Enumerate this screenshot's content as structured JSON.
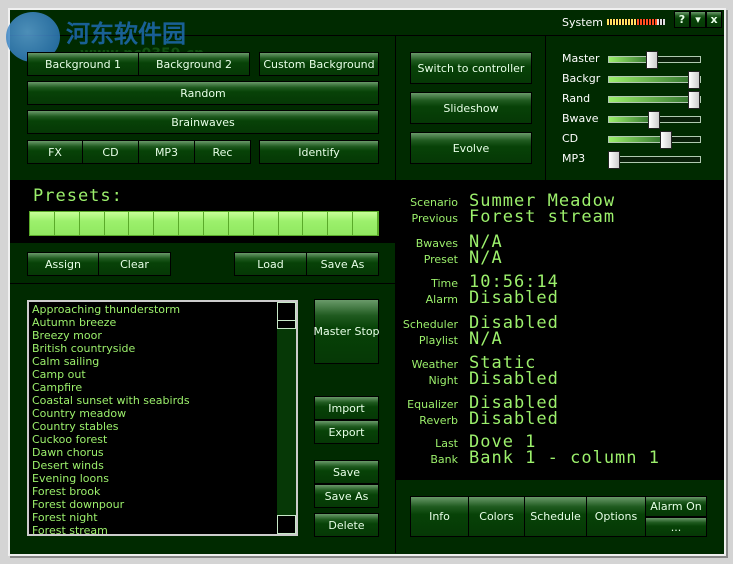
{
  "watermark": {
    "name": "河东软件园",
    "url": "www.pc0359.cn"
  },
  "titlebar": {
    "system_label": "System",
    "help": "?",
    "minimize": "▾",
    "close": "x"
  },
  "colors": {
    "background": "#002a00",
    "display_text": "#9cf06c",
    "display_bg": "#000000"
  },
  "background_buttons": {
    "bg1": "Background 1",
    "bg2": "Background 2",
    "custom": "Custom Background",
    "random": "Random",
    "brainwaves": "Brainwaves",
    "fx": "FX",
    "cd": "CD",
    "mp3": "MP3",
    "rec": "Rec",
    "identify": "Identify"
  },
  "mode_buttons": {
    "switch": "Switch to controller",
    "slideshow": "Slideshow",
    "evolve": "Evolve"
  },
  "sliders": [
    {
      "label": "Master",
      "value": 0.48
    },
    {
      "label": "Backgr",
      "value": 1.0
    },
    {
      "label": "Rand",
      "value": 1.0
    },
    {
      "label": "Bwave",
      "value": 0.5
    },
    {
      "label": "CD",
      "value": 0.65
    },
    {
      "label": "MP3",
      "value": 0.0
    }
  ],
  "presets": {
    "title": "Presets:",
    "slots": 14,
    "assign": "Assign",
    "clear": "Clear",
    "load": "Load",
    "save_as": "Save As"
  },
  "scenarios": [
    "Approaching thunderstorm",
    "Autumn breeze",
    "Breezy moor",
    "British countryside",
    "Calm sailing",
    "Camp out",
    "Campfire",
    "Coastal sunset with seabirds",
    "Country meadow",
    "Country stables",
    "Cuckoo forest",
    "Dawn chorus",
    "Desert winds",
    "Evening loons",
    "Forest brook",
    "Forest downpour",
    "Forest night",
    "Forest stream"
  ],
  "side_buttons": {
    "master_stop": "Master Stop",
    "import": "Import",
    "export": "Export",
    "save": "Save",
    "save_as": "Save As",
    "delete": "Delete"
  },
  "info": [
    {
      "label": "Scenario",
      "value": "Summer Meadow"
    },
    {
      "label": "Previous",
      "value": "Forest stream"
    },
    {
      "label": "Bwaves",
      "value": "N/A"
    },
    {
      "label": "Preset",
      "value": "N/A"
    },
    {
      "label": "Time",
      "value": "10:56:14"
    },
    {
      "label": "Alarm",
      "value": "Disabled"
    },
    {
      "label": "Scheduler",
      "value": "Disabled"
    },
    {
      "label": "Playlist",
      "value": "N/A"
    },
    {
      "label": "Weather",
      "value": "Static"
    },
    {
      "label": "Night",
      "value": "Disabled"
    },
    {
      "label": "Equalizer",
      "value": "Disabled"
    },
    {
      "label": "Reverb",
      "value": "Disabled"
    },
    {
      "label": "Last",
      "value": "Dove 1"
    },
    {
      "label": "Bank",
      "value": "Bank 1 - column 1"
    }
  ],
  "bottom_buttons": {
    "info": "Info",
    "colors": "Colors",
    "schedule": "Schedule",
    "options": "Options",
    "alarm_on": "Alarm On",
    "more": "..."
  }
}
